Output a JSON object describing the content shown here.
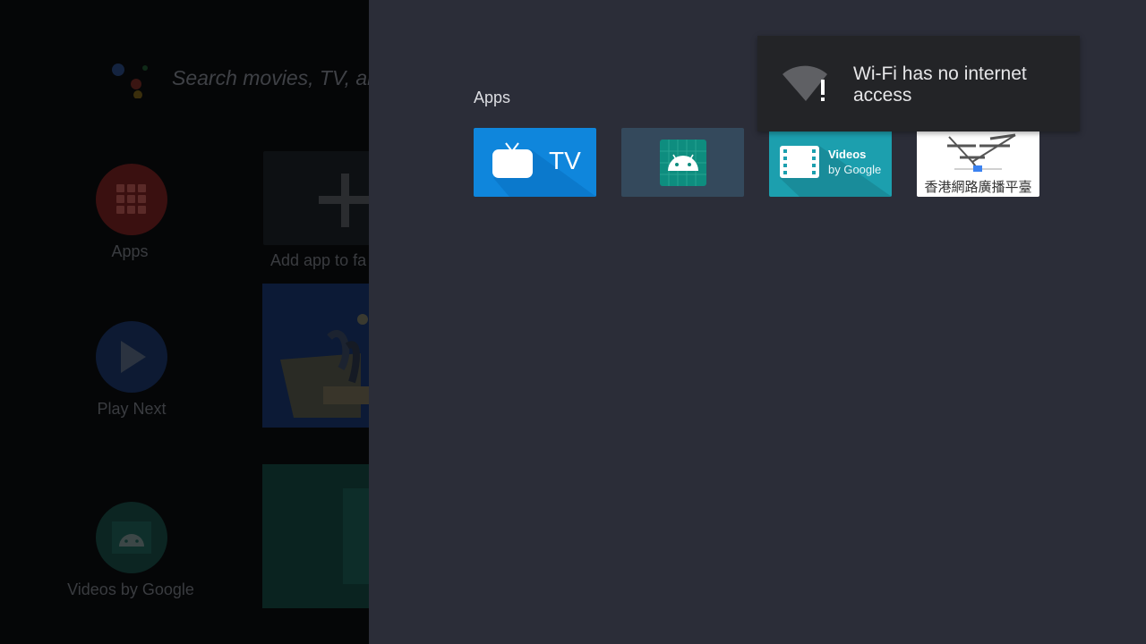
{
  "launcher": {
    "search_placeholder": "Search movies, TV, an",
    "apps_label": "Apps",
    "play_next_label": "Play Next",
    "videos_label": "Videos by Google",
    "add_app_label": "Add app to fa"
  },
  "apps_panel": {
    "title": "Apps",
    "tiles": [
      {
        "name": "TV",
        "text": "TV",
        "icon": "tv-icon"
      },
      {
        "name": "Android app",
        "icon": "android-icon"
      },
      {
        "name": "Videos by Google",
        "title": "Videos",
        "subtitle": "by Google",
        "icon": "film-icon"
      },
      {
        "name": "香港網路廣播平臺",
        "label": "香港網路廣播平臺",
        "icon": "antenna-icon"
      }
    ]
  },
  "toast": {
    "message": "Wi-Fi has no internet access",
    "icon": "wifi-no-internet-icon"
  },
  "colors": {
    "panel_bg": "#2b2d38",
    "tv_tile": "#0f86dc",
    "android_tile": "#34495c",
    "videos_tile": "#1c9fae",
    "toast_bg": "#232427"
  }
}
